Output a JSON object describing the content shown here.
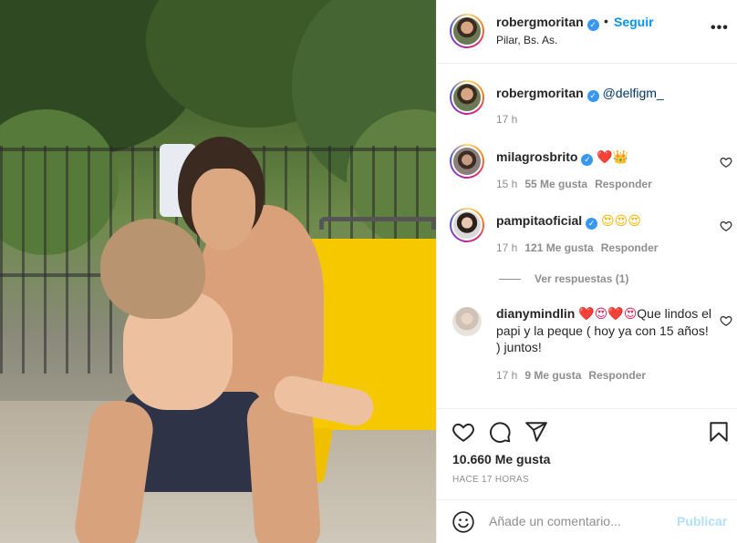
{
  "header": {
    "username": "robergmoritan",
    "dot": "•",
    "follow_label": "Seguir",
    "location": "Pilar, Bs. As.",
    "more_icon": "more-icon"
  },
  "caption": {
    "username": "robergmoritan",
    "mention": "@delfigm_",
    "time": "17 h"
  },
  "comments": [
    {
      "username": "milagrosbrito",
      "text": "❤️👑",
      "time": "15 h",
      "likes": "55 Me gusta",
      "reply": "Responder"
    },
    {
      "username": "pampitaoficial",
      "text": "😍😍😍",
      "time": "17 h",
      "likes": "121 Me gusta",
      "reply": "Responder",
      "view_replies": "Ver respuestas (1)"
    },
    {
      "username": "dianymindlin",
      "text_prefix": "❤️😍❤️😍",
      "text": "Que lindos el papi y la peque ( hoy ya con 15 años! ) juntos!",
      "time": "17 h",
      "likes": "9 Me gusta",
      "reply": "Responder"
    }
  ],
  "actions": {
    "likes": "10.660 Me gusta",
    "time_ago": "HACE 17 HORAS"
  },
  "comment_bar": {
    "placeholder": "Añade un comentario...",
    "publish": "Publicar"
  },
  "colors": {
    "accent": "#0095f6",
    "verified": "#3897f0",
    "muted": "#8e8e8e",
    "text": "#262626"
  }
}
